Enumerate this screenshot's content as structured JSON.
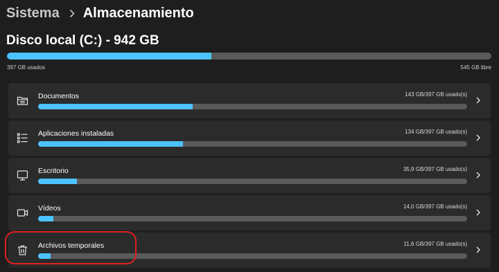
{
  "breadcrumb": {
    "parent": "Sistema",
    "current": "Almacenamiento"
  },
  "drive": {
    "title": "Disco local (C:) - 942 GB",
    "used_label": "397 GB usados",
    "free_label": "545 GB libre",
    "used_fraction": 0.4214
  },
  "categories": [
    {
      "label": "Documentos",
      "amount": "143 GB/397 GB usado(s)",
      "fraction": 0.3602,
      "icon": "folder-icon"
    },
    {
      "label": "Aplicaciones instaladas",
      "amount": "134 GB/397 GB usado(s)",
      "fraction": 0.3375,
      "icon": "app-list-icon"
    },
    {
      "label": "Escritorio",
      "amount": "35,9 GB/397 GB usado(s)",
      "fraction": 0.0904,
      "icon": "monitor-icon"
    },
    {
      "label": "Vídeos",
      "amount": "14,0 GB/397 GB usado(s)",
      "fraction": 0.0353,
      "icon": "video-camera-icon"
    },
    {
      "label": "Archivos temporales",
      "amount": "11,6 GB/397 GB usado(s)",
      "fraction": 0.0292,
      "icon": "trash-icon"
    }
  ],
  "colors": {
    "accent": "#4cc2ff",
    "highlight": "#e02020",
    "track": "#5a5a5a",
    "card": "#2b2b2b"
  }
}
